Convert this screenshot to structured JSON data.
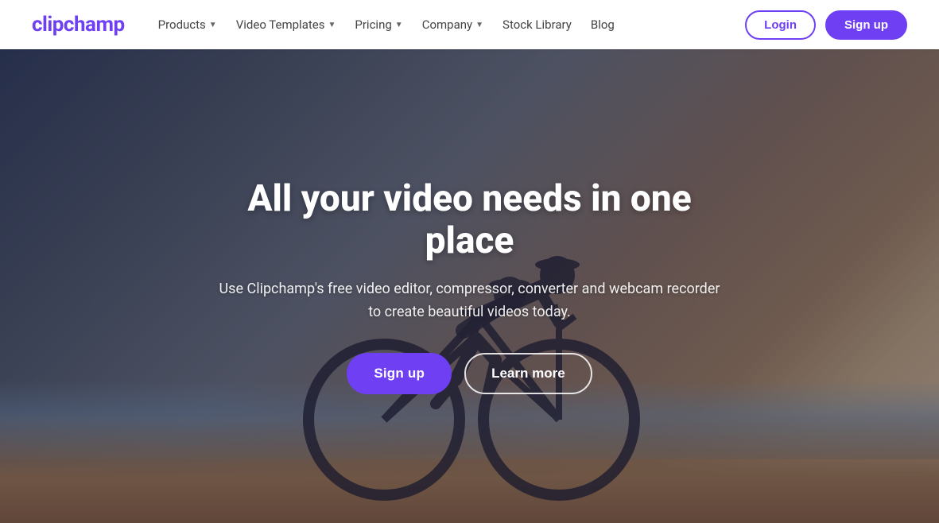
{
  "brand": {
    "logo_text": "clipchamp",
    "logo_color": "#6e3ff3"
  },
  "navbar": {
    "links": [
      {
        "label": "Products",
        "has_dropdown": true
      },
      {
        "label": "Video Templates",
        "has_dropdown": true
      },
      {
        "label": "Pricing",
        "has_dropdown": true
      },
      {
        "label": "Company",
        "has_dropdown": true
      },
      {
        "label": "Stock Library",
        "has_dropdown": false
      },
      {
        "label": "Blog",
        "has_dropdown": false
      }
    ],
    "login_label": "Login",
    "signup_label": "Sign up"
  },
  "hero": {
    "title": "All your video needs in one place",
    "subtitle": "Use Clipchamp's free video editor, compressor, converter and\nwebcam recorder to create beautiful videos today.",
    "cta_primary": "Sign up",
    "cta_secondary": "Learn more"
  }
}
